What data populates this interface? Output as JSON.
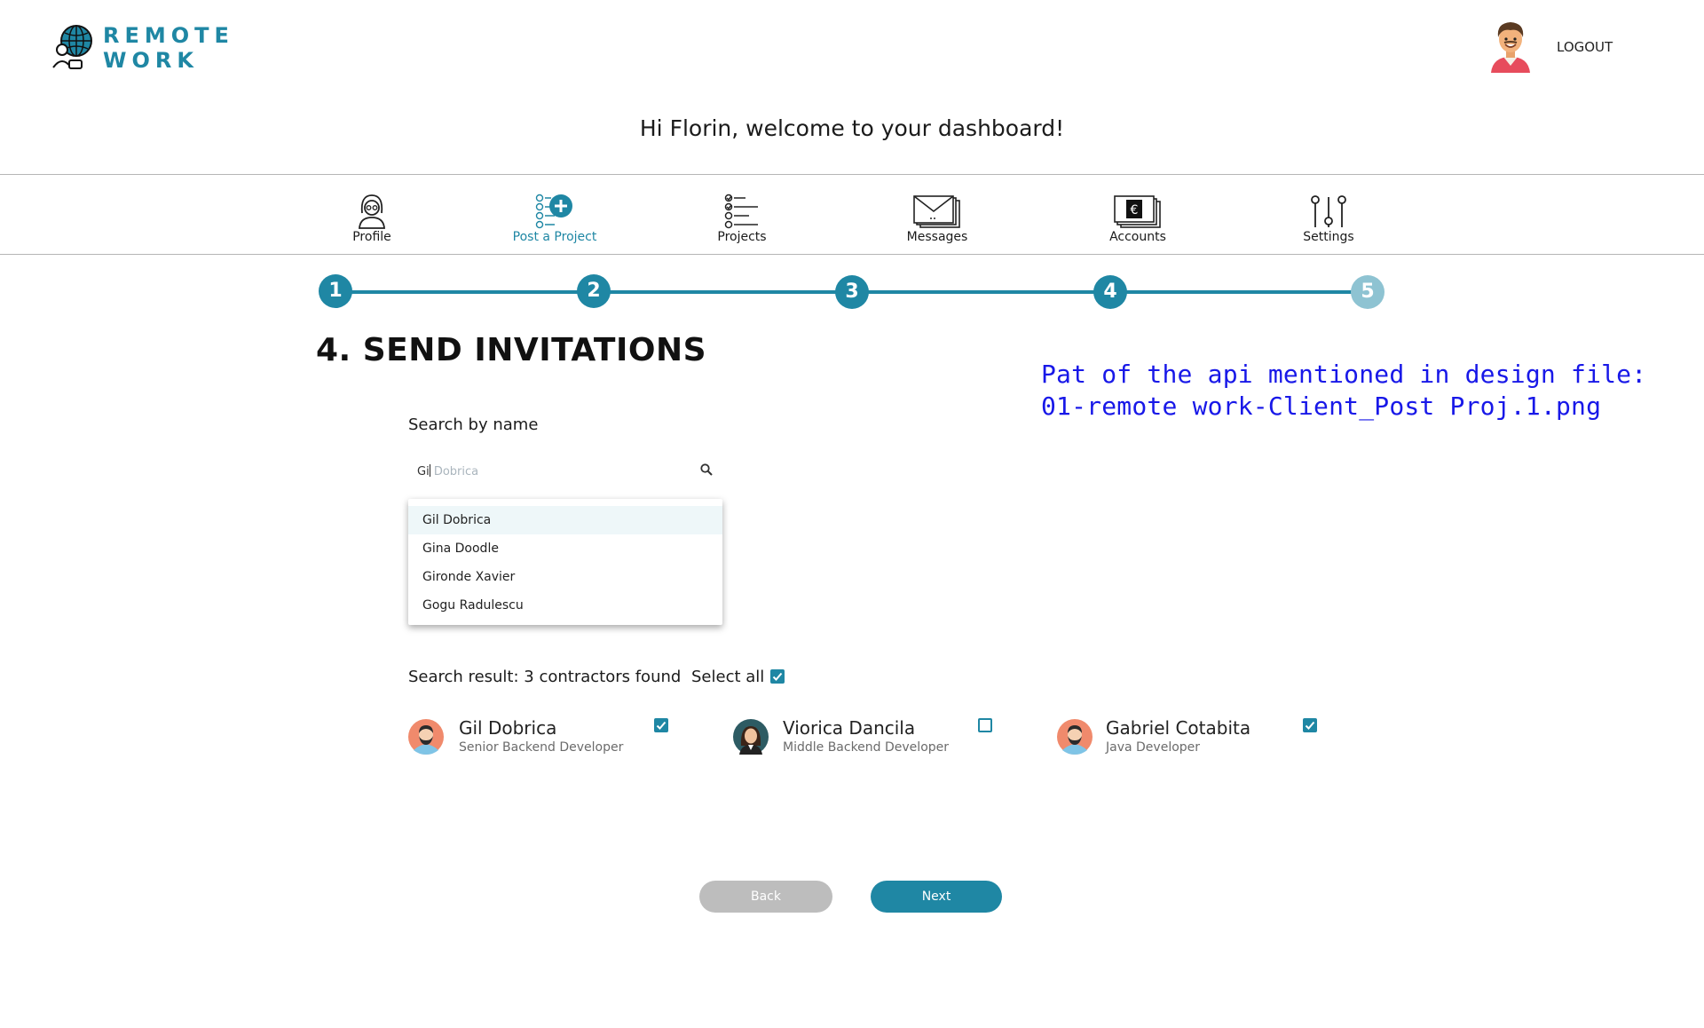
{
  "header": {
    "logo_line1": "REMOTE",
    "logo_line2": "WORK",
    "logout_label": "LOGOUT",
    "welcome": "Hi Florin, welcome to your dashboard!"
  },
  "nav": {
    "items": [
      {
        "label": "Profile",
        "icon": "profile-icon"
      },
      {
        "label": "Post a Project",
        "icon": "post-project-icon",
        "active": true
      },
      {
        "label": "Projects",
        "icon": "checklist-icon"
      },
      {
        "label": "Messages",
        "icon": "envelope-icon"
      },
      {
        "label": "Accounts",
        "icon": "money-icon"
      },
      {
        "label": "Settings",
        "icon": "sliders-icon"
      }
    ]
  },
  "stepper": {
    "steps": [
      "1",
      "2",
      "3",
      "4",
      "5"
    ],
    "current": 4
  },
  "page_title": "4. SEND INVITATIONS",
  "note": {
    "line1": "Pat of the api mentioned in design file:",
    "line2": "01-remote work-Client_Post Proj.1.png"
  },
  "search": {
    "label": "Search by name",
    "typed": "Gi",
    "placeholder_rest": "Dobrica",
    "suggestions": [
      "Gil Dobrica",
      "Gina Doodle",
      "Gironde Xavier",
      "Gogu Radulescu"
    ]
  },
  "results": {
    "summary": "Search result: 3 contractors found",
    "select_all_label": "Select all",
    "select_all_checked": true,
    "contractors": [
      {
        "name": "Gil Dobrica",
        "role": "Senior Backend Developer",
        "checked": true
      },
      {
        "name": "Viorica Dancila",
        "role": "Middle Backend Developer",
        "checked": false
      },
      {
        "name": "Gabriel Cotabita",
        "role": "Java Developer",
        "checked": true
      }
    ]
  },
  "buttons": {
    "back": "Back",
    "next": "Next"
  },
  "colors": {
    "accent": "#1f87a4",
    "step_inactive": "#8ec3d2",
    "note_text": "#1818e8",
    "back_button": "#bdbdbd"
  }
}
